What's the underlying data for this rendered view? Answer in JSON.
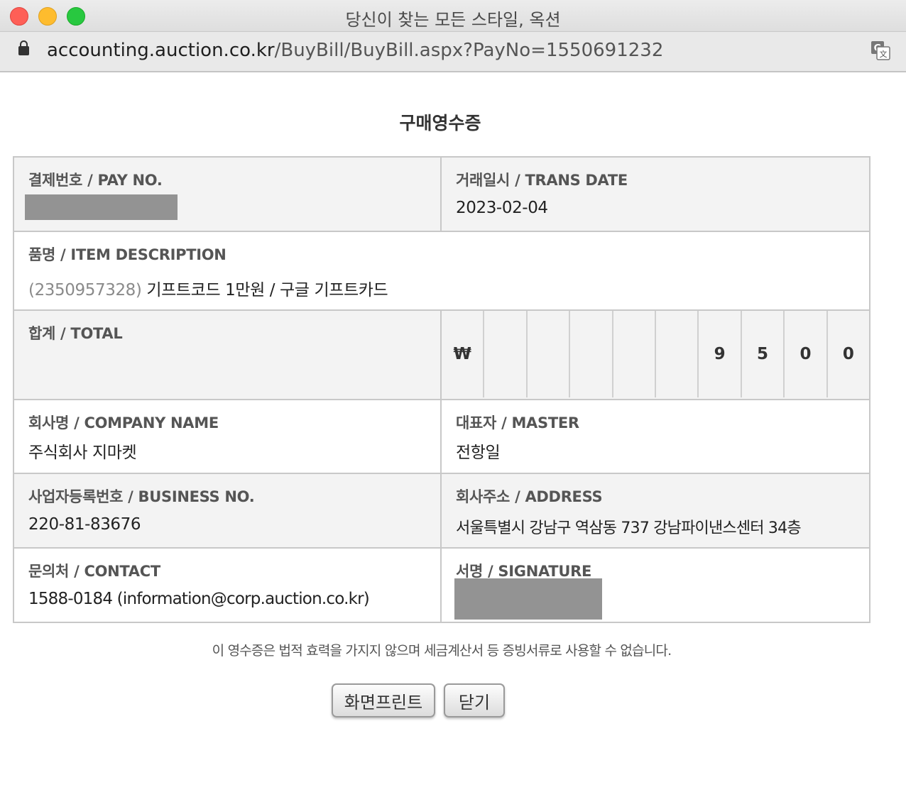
{
  "window": {
    "title": "당신이 찾는 모든 스타일, 옥션"
  },
  "address_bar": {
    "host": "accounting.auction.co.kr",
    "path": "/BuyBill/BuyBill.aspx?PayNo=1550691232"
  },
  "receipt": {
    "title": "구매영수증",
    "pay_no_label": "결제번호 / PAY NO.",
    "trans_date_label": "거래일시 / TRANS DATE",
    "trans_date": "2023-02-04",
    "item_label": "품명 / ITEM DESCRIPTION",
    "item_code": "(2350957328)",
    "item_name": "기프트코드 1만원 / 구글 기프트카드",
    "total_label": "합계 / TOTAL",
    "total_digits": [
      "₩",
      "",
      "",
      "",
      "",
      "",
      "9",
      "5",
      "0",
      "0"
    ],
    "company_label": "회사명 / COMPANY NAME",
    "company": "주식회사 지마켓",
    "master_label": "대표자 / MASTER",
    "master": "전항일",
    "business_no_label": "사업자등록번호 / BUSINESS NO.",
    "business_no": "220-81-83676",
    "address_label": "회사주소 / ADDRESS",
    "address": "서울특별시 강남구 역삼동 737 강남파이낸스센터 34층",
    "contact_label": "문의처 / CONTACT",
    "contact": "1588-0184 (information@corp.auction.co.kr)",
    "signature_label": "서명 / SIGNATURE"
  },
  "notice": "이 영수증은 법적 효력을 가지지 않으며 세금계산서 등 증빙서류로 사용할 수 없습니다.",
  "buttons": {
    "print": "화면프린트",
    "close": "닫기"
  }
}
